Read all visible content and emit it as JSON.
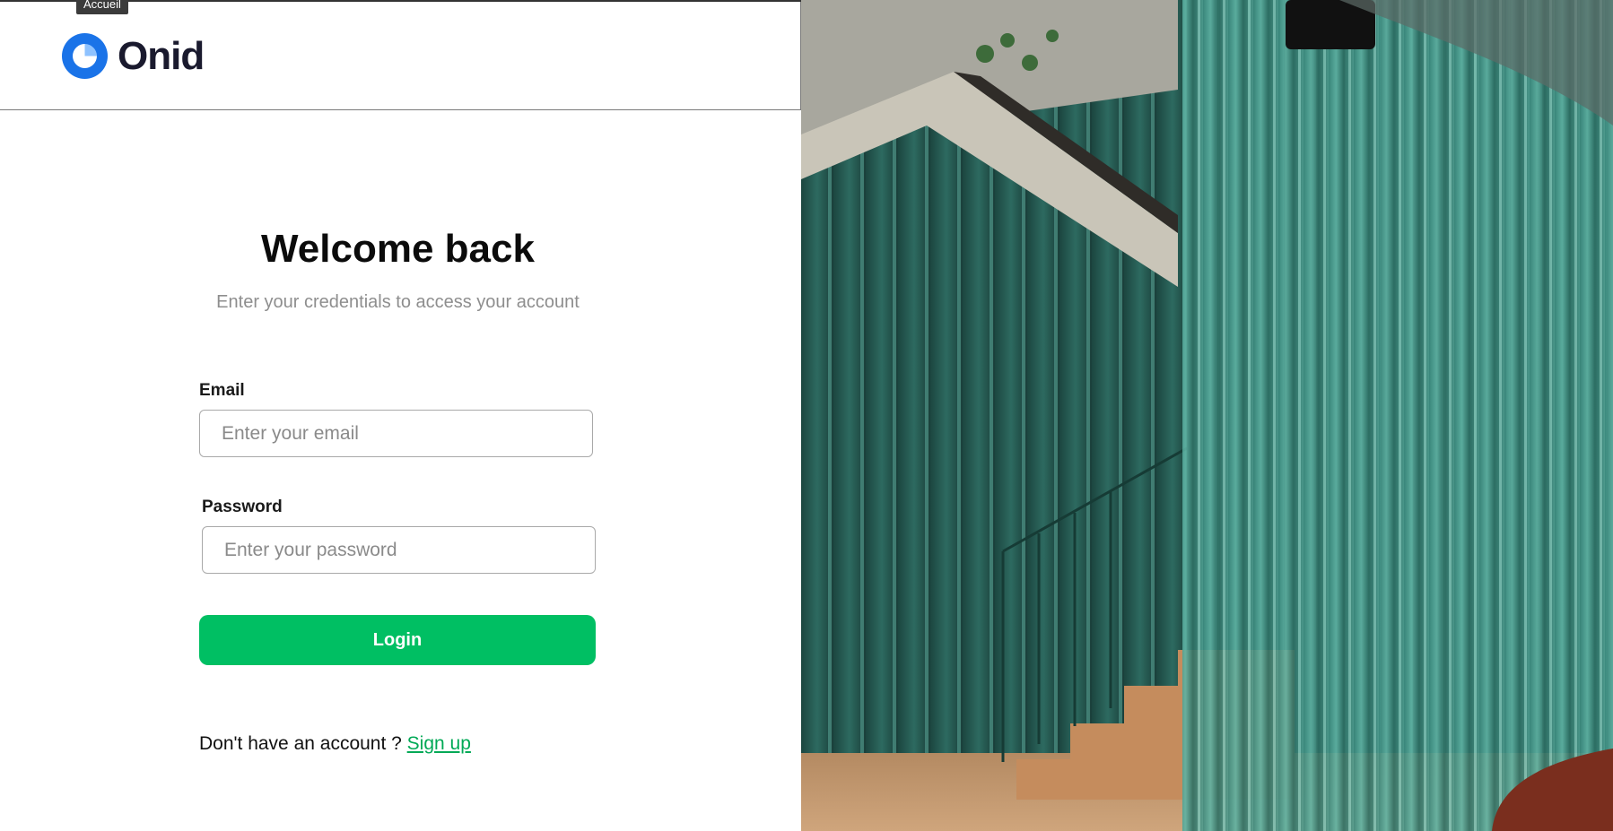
{
  "tooltip": {
    "text": "Accueil"
  },
  "brand": {
    "name": "Onid",
    "logo_icon": "onid-logo-icon",
    "accent": "#1a73e8"
  },
  "login": {
    "title": "Welcome back",
    "subtitle": "Enter your credentials to access your account",
    "email_label": "Email",
    "email_placeholder": "Enter your email",
    "email_value": "",
    "password_label": "Password",
    "password_placeholder": "Enter your password",
    "password_value": "",
    "button_label": "Login",
    "button_color": "#00bf63"
  },
  "signup": {
    "prompt": "Don't have an account ? ",
    "link_label": "Sign up",
    "link_color": "#00a956"
  },
  "hero_image": {
    "icon": "staircase-photo"
  }
}
